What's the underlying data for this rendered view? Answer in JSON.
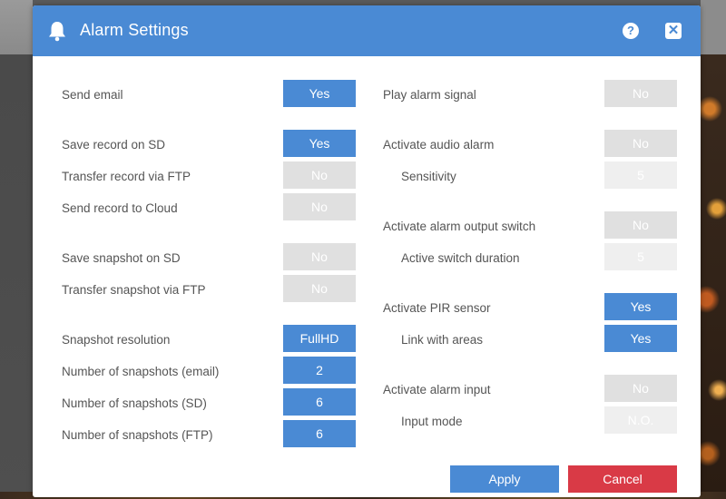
{
  "dialog": {
    "title": "Alarm Settings",
    "help_label": "?",
    "close_label": "✕"
  },
  "left": {
    "send_email": {
      "label": "Send email",
      "value": "Yes"
    },
    "save_record_sd": {
      "label": "Save record on SD",
      "value": "Yes"
    },
    "transfer_record_ftp": {
      "label": "Transfer record via FTP",
      "value": "No"
    },
    "send_record_cloud": {
      "label": "Send record to Cloud",
      "value": "No"
    },
    "save_snapshot_sd": {
      "label": "Save snapshot on SD",
      "value": "No"
    },
    "transfer_snapshot_ftp": {
      "label": "Transfer snapshot via FTP",
      "value": "No"
    },
    "snapshot_resolution": {
      "label": "Snapshot resolution",
      "value": "FullHD"
    },
    "snapshots_email": {
      "label": "Number of snapshots (email)",
      "value": "2"
    },
    "snapshots_sd": {
      "label": "Number of snapshots (SD)",
      "value": "6"
    },
    "snapshots_ftp": {
      "label": "Number of snapshots (FTP)",
      "value": "6"
    }
  },
  "right": {
    "play_alarm_signal": {
      "label": "Play alarm signal",
      "value": "No"
    },
    "activate_audio_alarm": {
      "label": "Activate audio alarm",
      "value": "No"
    },
    "sensitivity": {
      "label": "Sensitivity",
      "value": "5"
    },
    "activate_output_switch": {
      "label": "Activate alarm output switch",
      "value": "No"
    },
    "active_switch_duration": {
      "label": "Active switch duration",
      "value": "5"
    },
    "activate_pir": {
      "label": "Activate PIR sensor",
      "value": "Yes"
    },
    "link_with_areas": {
      "label": "Link with areas",
      "value": "Yes"
    },
    "activate_alarm_input": {
      "label": "Activate alarm input",
      "value": "No"
    },
    "input_mode": {
      "label": "Input mode",
      "value": "N.O."
    }
  },
  "footer": {
    "apply_label": "Apply",
    "cancel_label": "Cancel"
  },
  "colors": {
    "accent": "#4a8ad4",
    "cancel": "#d93a46",
    "toggle_off": "#e0e0e0",
    "toggle_disabled": "#efefef"
  }
}
